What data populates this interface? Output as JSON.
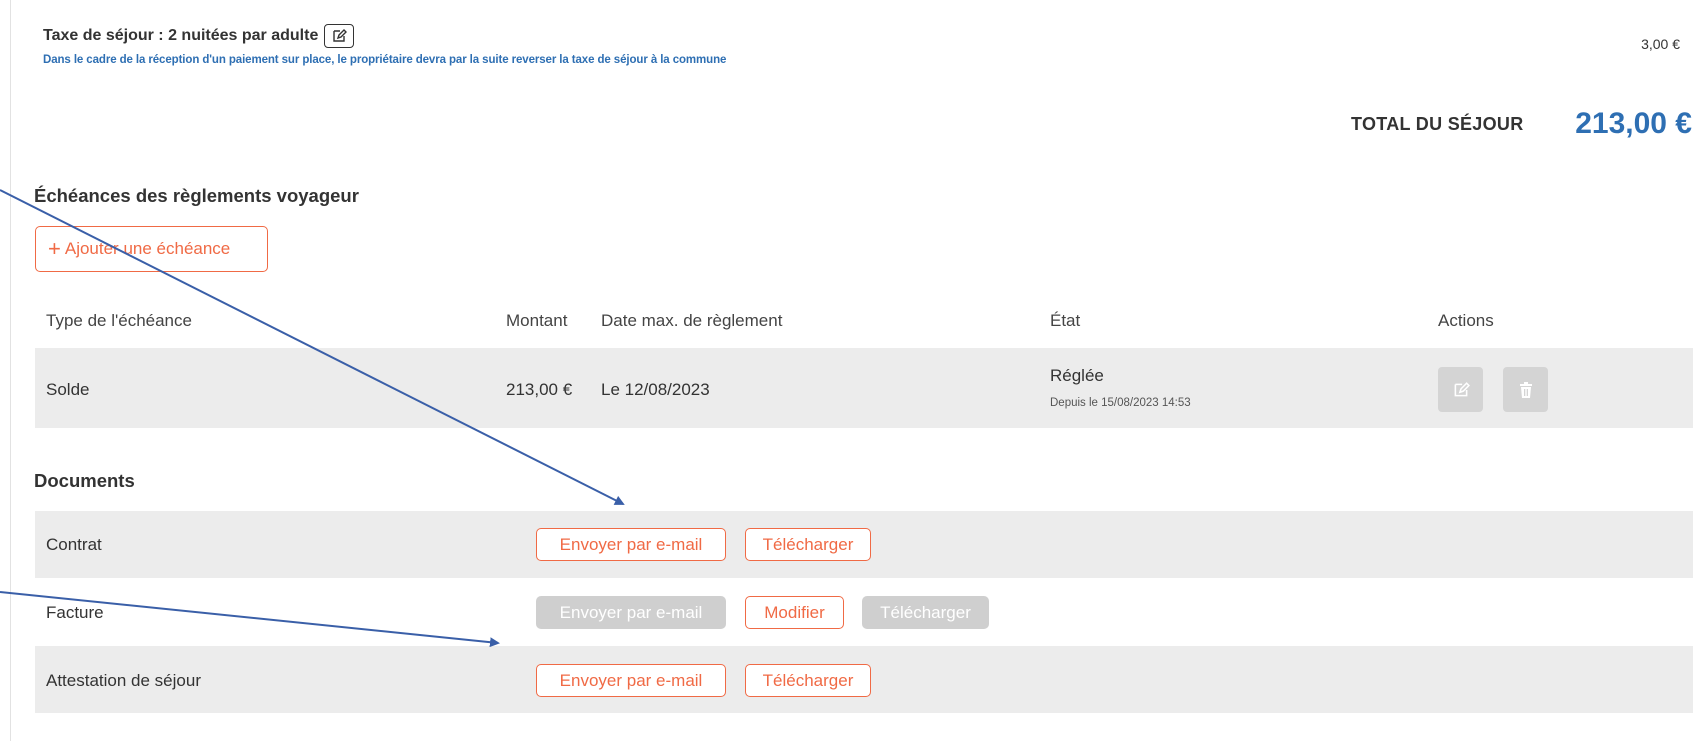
{
  "tax": {
    "title": "Taxe de séjour : 2 nuitées par adulte",
    "note": "Dans le cadre de la réception d'un paiement sur place, le propriétaire devra par la suite reverser la taxe de séjour à la commune",
    "amount": "3,00 €"
  },
  "total": {
    "label": "TOTAL DU SÉJOUR",
    "value": "213,00 €"
  },
  "echeances": {
    "title": "Échéances des règlements voyageur",
    "add_label": "Ajouter une échéance",
    "columns": {
      "type": "Type de l'échéance",
      "montant": "Montant",
      "date": "Date max. de règlement",
      "etat": "État",
      "actions": "Actions"
    },
    "rows": [
      {
        "type": "Solde",
        "montant": "213,00 €",
        "date": "Le 12/08/2023",
        "etat": "Réglée",
        "etat_detail": "Depuis le 15/08/2023 14:53"
      }
    ]
  },
  "documents": {
    "title": "Documents",
    "rows": [
      {
        "label": "Contrat",
        "email": "Envoyer par e-mail",
        "download": "Télécharger"
      },
      {
        "label": "Facture",
        "email": "Envoyer par e-mail",
        "modify": "Modifier",
        "download": "Télécharger"
      },
      {
        "label": "Attestation de séjour",
        "email": "Envoyer par e-mail",
        "download": "Télécharger"
      }
    ]
  },
  "colors": {
    "accent": "#f06a45",
    "link_blue": "#2e6fb3",
    "arrow": "#3a5fa8",
    "disabled": "#cfcfcf",
    "row_band": "#ececec"
  },
  "icons": {
    "edit": "edit-icon",
    "trash": "trash-icon",
    "plus": "plus-icon"
  }
}
